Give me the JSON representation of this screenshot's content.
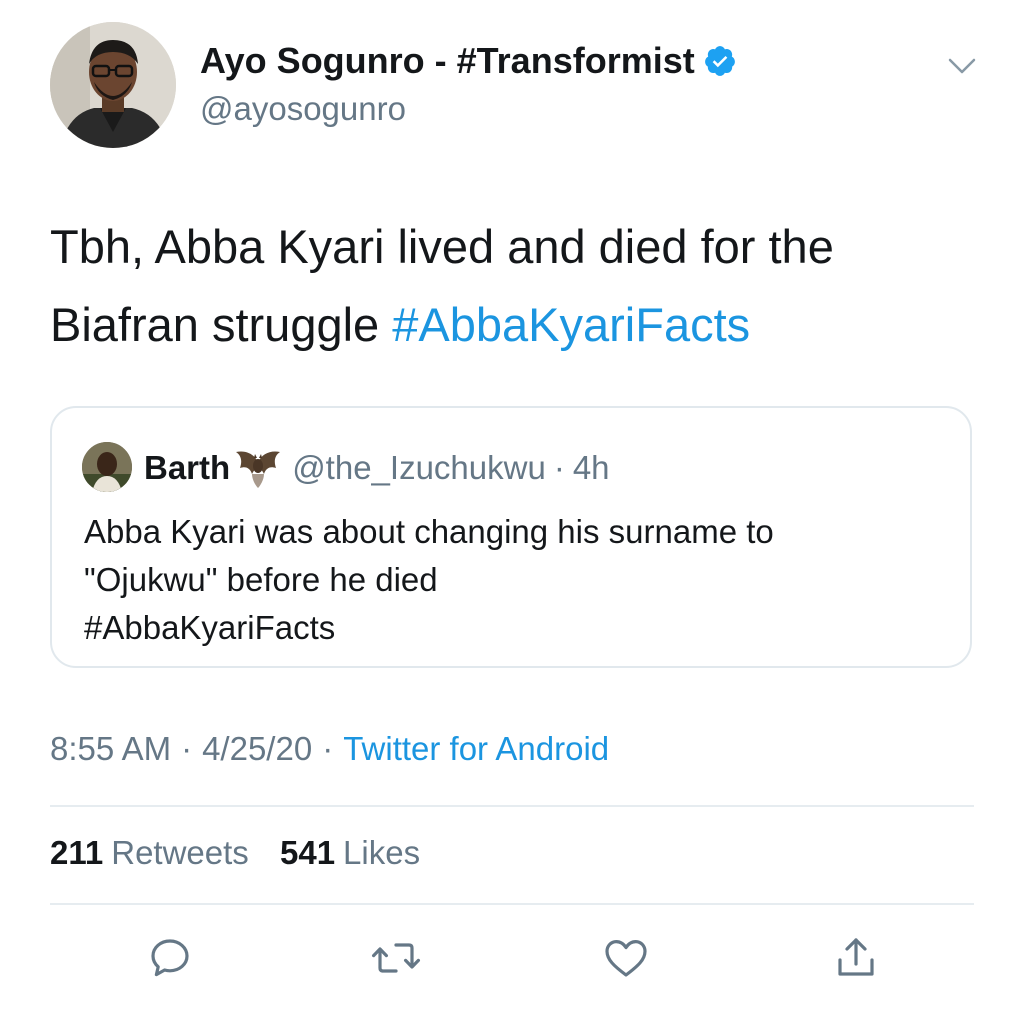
{
  "author": {
    "display_name": "Ayo Sogunro - #Transformist",
    "handle": "@ayosogunro",
    "verified": true
  },
  "tweet": {
    "text_plain": "Tbh, Abba Kyari lived and died for the Biafran struggle ",
    "hashtag": "#AbbaKyariFacts"
  },
  "quoted_tweet": {
    "display_name": "Barth",
    "handle": "@the_Izuchukwu",
    "separator": "·",
    "time": "4h",
    "text_line1": "Abba Kyari was about changing his surname to",
    "text_line2": "\"Ojukwu\" before he died",
    "text_line3": "#AbbaKyariFacts"
  },
  "meta": {
    "time": "8:55 AM",
    "date": "4/25/20",
    "source": "Twitter for Android",
    "separator": "·"
  },
  "stats": {
    "retweets_count": "211",
    "retweets_label": "Retweets",
    "likes_count": "541",
    "likes_label": "Likes"
  },
  "colors": {
    "link": "#1b95e0",
    "secondary_text": "#657786",
    "primary_text": "#14171a",
    "border": "#e1e8ed"
  },
  "icons": [
    "verified-badge-icon",
    "chevron-down-icon",
    "bat-emoji-icon",
    "reply-icon",
    "retweet-icon",
    "like-icon",
    "share-icon"
  ]
}
